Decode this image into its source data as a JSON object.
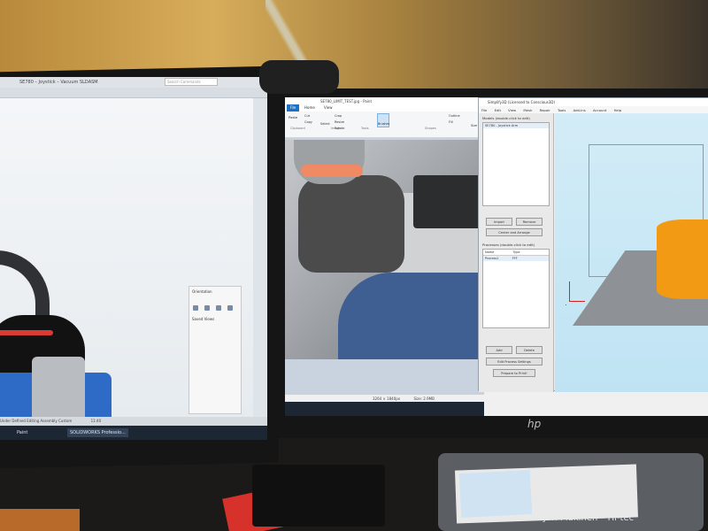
{
  "left_screen": {
    "window_title": "SE780 – Joystick – Vacuum SLDASM",
    "search_placeholder": "Search Commands",
    "status_bar": "Under Defined    Editing Assembly    Custom",
    "clock": "11:40",
    "taskbar_items": [
      "Paint",
      "SOLIDWORKS Professio..."
    ],
    "task_pane": {
      "title": "Orientation",
      "saved_views_label": "Saved Views"
    }
  },
  "right_screen": {
    "paint": {
      "title": "SE780_LIMIT_TEST.jpg - Paint",
      "tabs": [
        "File",
        "Home",
        "View"
      ],
      "ribbon_buttons": [
        "Paste",
        "Cut",
        "Copy",
        "Select",
        "Crop",
        "Resize",
        "Rotate",
        "Brushes",
        "Outline",
        "Fill",
        "Size"
      ],
      "ribbon_groups": [
        "Clipboard",
        "Image",
        "Tools",
        "Shapes"
      ],
      "status_dimensions": "3264 × 1840px",
      "status_size": "Size: 2.9MB"
    },
    "simplify3d": {
      "title": "Simplify3D (Licensed to Conscious3D)",
      "menu": [
        "File",
        "Edit",
        "View",
        "Mesh",
        "Repair",
        "Tools",
        "Add-Ins",
        "Account",
        "Help"
      ],
      "models_label": "Models (double-click to edit)",
      "models": [
        "SE780 - Joystick Arm"
      ],
      "model_buttons": [
        "Import",
        "Remove"
      ],
      "center_arrange": "Center and Arrange",
      "processes_label": "Processes (double-click to edit)",
      "process_headers": [
        "Name",
        "Type"
      ],
      "processes": [
        {
          "name": "Process1",
          "type": "FFF"
        }
      ],
      "process_buttons": [
        "Add",
        "Delete"
      ],
      "edit_process": "Edit Process Settings",
      "prepare_print": "Prepare to Print!"
    },
    "monitor_brand": "hp"
  },
  "watermark": "Jori Mäkinen – Hi-tec"
}
